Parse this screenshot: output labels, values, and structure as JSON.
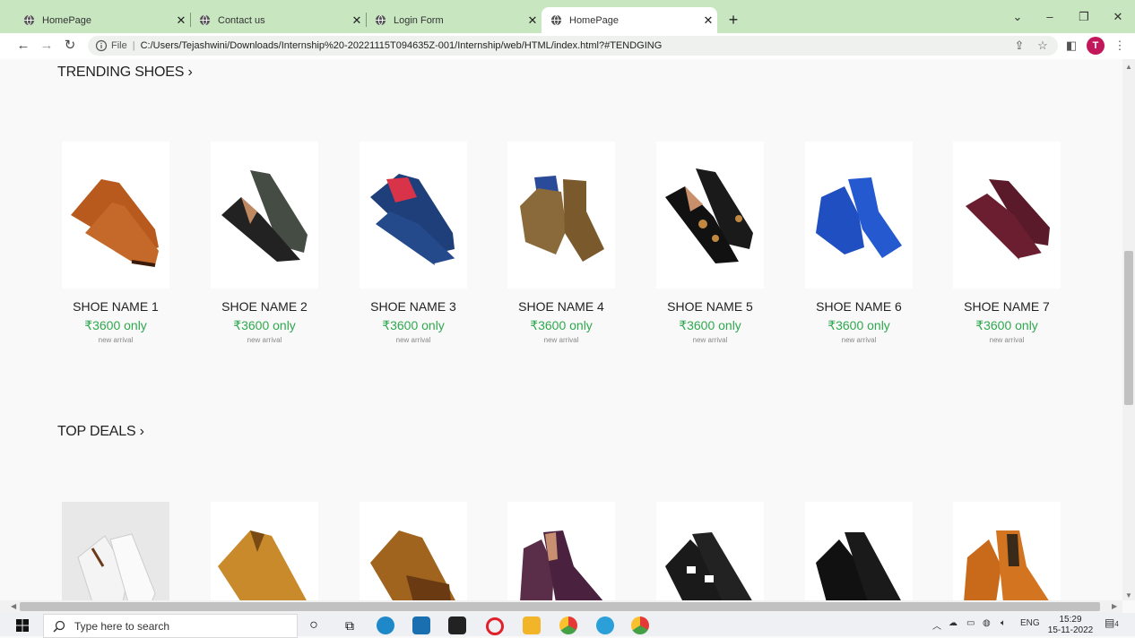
{
  "browser": {
    "tabs": [
      {
        "title": "HomePage",
        "active": false
      },
      {
        "title": "Contact us",
        "active": false
      },
      {
        "title": "Login Form",
        "active": false
      },
      {
        "title": "HomePage",
        "active": true
      }
    ],
    "new_tab_label": "+",
    "scheme": "File",
    "separator": "|",
    "url": "C:/Users/Tejashwini/Downloads/Internship%20-20221115T094635Z-001/Internship/web/HTML/index.html?#TENDGING",
    "avatar_letter": "T"
  },
  "trending": {
    "title": "TRENDING SHOES ›",
    "items": [
      {
        "name": "SHOE NAME 1",
        "price": "₹3600 only",
        "note": "new arrival"
      },
      {
        "name": "SHOE NAME 2",
        "price": "₹3600 only",
        "note": "new arrival"
      },
      {
        "name": "SHOE NAME 3",
        "price": "₹3600 only",
        "note": "new arrival"
      },
      {
        "name": "SHOE NAME 4",
        "price": "₹3600 only",
        "note": "new arrival"
      },
      {
        "name": "SHOE NAME 5",
        "price": "₹3600 only",
        "note": "new arrival"
      },
      {
        "name": "SHOE NAME 6",
        "price": "₹3600 only",
        "note": "new arrival"
      },
      {
        "name": "SHOE NAME 7",
        "price": "₹3600 only",
        "note": "new arrival"
      }
    ]
  },
  "deals": {
    "title": "TOP DEALS ›"
  },
  "taskbar": {
    "search_placeholder": "Type here to search",
    "lang": "ENG",
    "time": "15:29",
    "date": "15-11-2022",
    "notification_count": "4"
  },
  "colors": {
    "tabbar": "#c8e6c0",
    "price": "#2fa84f",
    "avatar": "#c2185b"
  }
}
